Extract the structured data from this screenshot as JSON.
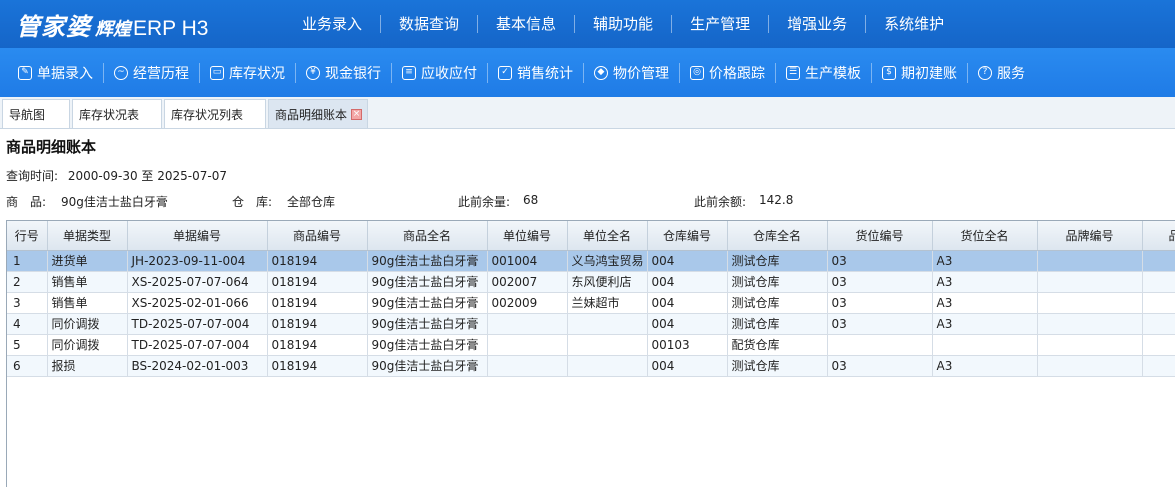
{
  "app": {
    "brand_main": "管家婆",
    "brand_sub": "辉煌",
    "brand_product": "ERP H3"
  },
  "top_nav": [
    "业务录入",
    "数据查询",
    "基本信息",
    "辅助功能",
    "生产管理",
    "增强业务",
    "系统维护"
  ],
  "toolbar": [
    {
      "label": "单据录入",
      "icon": "pencil-icon"
    },
    {
      "label": "经营历程",
      "icon": "trend-icon"
    },
    {
      "label": "库存状况",
      "icon": "box-icon"
    },
    {
      "label": "现金银行",
      "icon": "yen-icon"
    },
    {
      "label": "应收应付",
      "icon": "ledger-icon"
    },
    {
      "label": "销售统计",
      "icon": "edit-chart-icon"
    },
    {
      "label": "物价管理",
      "icon": "shield-icon"
    },
    {
      "label": "价格跟踪",
      "icon": "track-icon"
    },
    {
      "label": "生产模板",
      "icon": "list-icon"
    },
    {
      "label": "期初建账",
      "icon": "book-icon"
    },
    {
      "label": "服务",
      "icon": "help-icon"
    }
  ],
  "tabs": [
    {
      "label": "导航图"
    },
    {
      "label": "库存状况表"
    },
    {
      "label": "库存状况列表"
    },
    {
      "label": "商品明细账本",
      "active": true
    }
  ],
  "page": {
    "title": "商品明细账本",
    "query_label": "查询时间:",
    "query_value": "2000-09-30 至 2025-07-07",
    "product_label": "商　品:",
    "product_value": "90g佳洁士盐白牙膏",
    "warehouse_label": "仓　库:",
    "warehouse_value": "全部仓库",
    "prev_qty_label": "此前余量:",
    "prev_qty_value": "68",
    "prev_amount_label": "此前余额:",
    "prev_amount_value": "142.8"
  },
  "table": {
    "columns": [
      "行号",
      "单据类型",
      "单据编号",
      "商品编号",
      "商品全名",
      "单位编号",
      "单位全名",
      "仓库编号",
      "仓库全名",
      "货位编号",
      "货位全名",
      "品牌编号",
      "品"
    ],
    "rows": [
      [
        "1",
        "进货单",
        "JH-2023-09-11-004",
        "018194",
        "90g佳洁士盐白牙膏",
        "001004",
        "义乌鸿宝贸易",
        "004",
        "测试仓库",
        "03",
        "A3",
        "",
        ""
      ],
      [
        "2",
        "销售单",
        "XS-2025-07-07-064",
        "018194",
        "90g佳洁士盐白牙膏",
        "002007",
        "东风便利店",
        "004",
        "测试仓库",
        "03",
        "A3",
        "",
        ""
      ],
      [
        "3",
        "销售单",
        "XS-2025-02-01-066",
        "018194",
        "90g佳洁士盐白牙膏",
        "002009",
        "兰妹超市",
        "004",
        "测试仓库",
        "03",
        "A3",
        "",
        ""
      ],
      [
        "4",
        "同价调拨",
        "TD-2025-07-07-004",
        "018194",
        "90g佳洁士盐白牙膏",
        "",
        "",
        "004",
        "测试仓库",
        "03",
        "A3",
        "",
        ""
      ],
      [
        "5",
        "同价调拨",
        "TD-2025-07-07-004",
        "018194",
        "90g佳洁士盐白牙膏",
        "",
        "",
        "00103",
        "配货仓库",
        "",
        "",
        "",
        ""
      ],
      [
        "6",
        "报损",
        "BS-2024-02-01-003",
        "018194",
        "90g佳洁士盐白牙膏",
        "",
        "",
        "004",
        "测试仓库",
        "03",
        "A3",
        "",
        ""
      ]
    ]
  }
}
